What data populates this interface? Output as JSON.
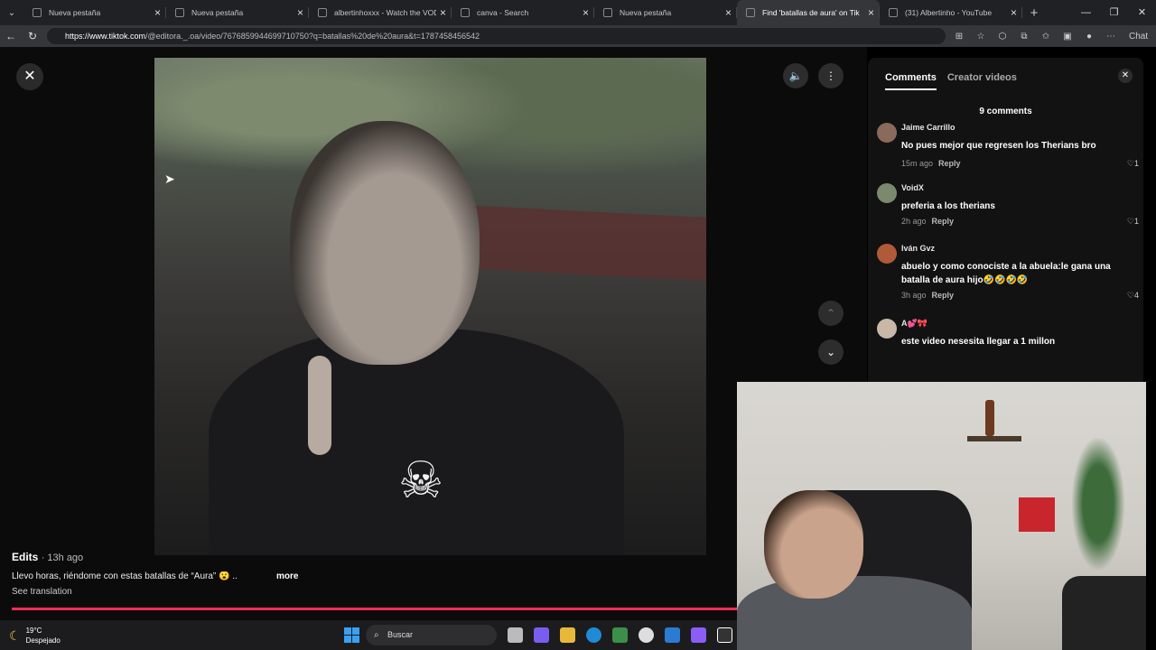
{
  "browser": {
    "tabs": [
      {
        "title": "Nueva pestaña",
        "active": false
      },
      {
        "title": "Nueva pestaña",
        "active": false
      },
      {
        "title": "albertinhoxxx - Watch the VOD o",
        "active": false
      },
      {
        "title": "canva - Search",
        "active": false
      },
      {
        "title": "Nueva pestaña",
        "active": false
      },
      {
        "title": "Find 'batallas de aura' on Tik",
        "active": true
      },
      {
        "title": "(31) Albertinho - YouTube",
        "active": false
      }
    ],
    "url_host": "https://www.tiktok.com",
    "url_path": "/@editora._.oa/video/7676859944699710750?q=batallas%20de%20aura&t=1787458456542",
    "chat_label": "Chat"
  },
  "video": {
    "author": "Edits",
    "time_ago": "· 13h ago",
    "caption": "Llevo horas, riéndome con estas batallas de “Aura” 😮 ...",
    "more_label": "more",
    "see_translation": "See translation",
    "progress": 1.0,
    "skull_glyph": "☠"
  },
  "panel": {
    "tab_comments": "Comments",
    "tab_creator": "Creator videos",
    "count_label": "9 comments",
    "comments": [
      {
        "user": "Jaime Carrillo",
        "text": "No pues mejor que regresen los Therians bro",
        "time": "15m ago",
        "reply": "Reply",
        "likes": "1",
        "avatar_color": "#8a6a5a"
      },
      {
        "user": "VoidX",
        "text": "preferia a los therians",
        "time": "2h ago",
        "reply": "Reply",
        "likes": "1",
        "avatar_color": "#7b8a6f"
      },
      {
        "user": "Iván Gvz",
        "text": "abuelo y como conociste a la abuela:le gana una batalla de aura hijo🤣🤣🤣🤣",
        "time": "3h ago",
        "reply": "Reply",
        "likes": "4",
        "avatar_color": "#b05a3a"
      },
      {
        "user": "A💕🎀",
        "text": "este video nesesita llegar a 1 millon",
        "avatar_color": "#c9b8a8"
      }
    ]
  },
  "taskbar": {
    "temperature": "19°C",
    "condition": "Despejado",
    "search_placeholder": "Buscar"
  },
  "colors": {
    "accent": "#fe2c55",
    "panel_bg": "#121212"
  }
}
